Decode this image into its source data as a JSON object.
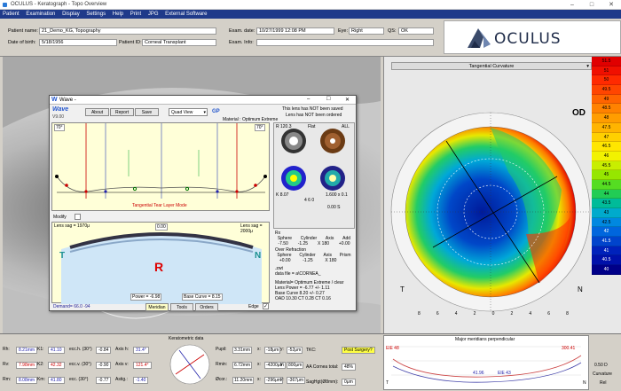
{
  "window": {
    "title": "OCULUS - Keratograph - Topo Overview"
  },
  "menu": [
    "Patient",
    "Examination",
    "Display",
    "Settings",
    "Help",
    "Print",
    "JPG",
    "External Software"
  ],
  "patient": {
    "name_label": "Patient name:",
    "name": "21_Demo_KG, Topography",
    "dob_label": "Date of birth:",
    "dob": "5/18/1956",
    "id_label": "Patient ID:",
    "id": "Corneal Transplant",
    "exam_date_label": "Exam. date:",
    "exam_date": "10/27/1999 12:08 PM",
    "eye_label": "Eye:",
    "eye": "Right",
    "qs_label": "QS:",
    "qs": "OK",
    "exam_info_label": "Exam. Info:",
    "exam_info": ""
  },
  "brand": "OCULUS",
  "map": {
    "dropdown": "Tangential Curvature",
    "eye": "OD",
    "left_label": "T",
    "right_label": "N",
    "axis_ticks": [
      "8",
      "6",
      "4",
      "2",
      "0",
      "2",
      "4",
      "6",
      "8"
    ]
  },
  "scale": {
    "values": [
      "51.5",
      "51",
      "50",
      "49.5",
      "49",
      "48.5",
      "48",
      "47.5",
      "47",
      "46.5",
      "46",
      "45.5",
      "45",
      "44.5",
      "44",
      "43.5",
      "43",
      "42.5",
      "42",
      "41.5",
      "41",
      "40.5",
      "40"
    ],
    "colors": [
      "#e00000",
      "#f01000",
      "#ff2a00",
      "#ff4500",
      "#ff6400",
      "#ff8200",
      "#ff9d00",
      "#ffb400",
      "#ffd000",
      "#ffe600",
      "#f2f200",
      "#c8ee00",
      "#96e600",
      "#55dd22",
      "#22cc55",
      "#00bb99",
      "#00aacc",
      "#0088e0",
      "#0066dd",
      "#0044cc",
      "#0022bb",
      "#0011aa",
      "#000088"
    ],
    "step": "0.50 D",
    "unit_label": "Curvature",
    "abs": "Rel"
  },
  "wave": {
    "title": "Wave -",
    "version": "V9.00",
    "buttons": [
      "About",
      "Report",
      "Save"
    ],
    "view": "Quad View",
    "gp": "GP",
    "material": "Material : Optimum Extreme",
    "warn1": "This lens has NOT been saved",
    "warn2": "Lens has NOT been ordered",
    "mode": "Tangential Tear Layer Mode",
    "modify": "Modify",
    "sag_left": "Lens sag = 1970μ",
    "sag_right": "Lens sag = 2000μ",
    "left_box": "70°",
    "right_box": "70°",
    "top_val": "0.00",
    "letters": {
      "t": "T",
      "r": "R",
      "n": "N"
    },
    "power": "Power = -6.98",
    "base": "Base Curve = 8.15",
    "demand": "Demand= 66.0 -94",
    "tabs": [
      "Meridian",
      "Tools",
      "Orders"
    ],
    "edge": "Edge",
    "rx_title": "Rx",
    "rx_headers": [
      "Sphere",
      "Cylinder",
      "Axis",
      "Add"
    ],
    "rx_values": [
      "-7.50",
      "-1.25",
      "X 180",
      "+0.00"
    ],
    "over_title": "Over Refraction",
    "over_headers": [
      "Sphere",
      "Cylinder",
      "Axis",
      "Prism"
    ],
    "over_values": [
      "+0.00",
      "-1.25",
      "X 180",
      ""
    ],
    "zwt": ".zwt",
    "data_file": "data file = a\\CORNEA_",
    "notes": [
      "Material= Optimum Extreme / clear",
      "Lens Power = -6.77 +/- 1.11",
      "Base Curve 8.20 +/- 0.27",
      "OAD 10.30 CT 0.28 CT 0.16"
    ],
    "thumb_labels": [
      "R 120.3",
      "Flat",
      "ALL",
      "K 8.07",
      "4 6 0",
      "1.600 x 0.1"
    ],
    "zoom": "0.00 S"
  },
  "kerato": {
    "title": "Keratometric data",
    "rows": [
      {
        "c1": "Rh:",
        "v1": "8.21mm",
        "c2": "K1:",
        "v2": "41.10",
        "c3": "ecc.h. (30°)",
        "v3": "-0.84",
        "c4": "Axis h:",
        "v4": "31.4°"
      },
      {
        "c1": "Rv:",
        "v1": "7.98mm",
        "c2": "K2:",
        "v2": "42.32",
        "c3": "ecc.v. (30°)",
        "v3": "-0.90",
        "c4": "Axis v:",
        "v4": "121.4°"
      },
      {
        "c1": "Rm:",
        "v1": "8.08mm",
        "c2": "Km:",
        "v2": "41.80",
        "c3": "ecc. (30°)",
        "v3": "-0.77",
        "c4": "Astig.:",
        "v4": "-1.40"
      }
    ],
    "meas": [
      {
        "a": "Pupil:",
        "av": "3.31mm",
        "b": "x:",
        "bv": "-18μm",
        "c": "y:",
        "cv": "-52μm"
      },
      {
        "a": "Rmin:",
        "av": "6.72mm",
        "b": "x:",
        "bv": "-4200μm",
        "c": "y:",
        "cv": "800μm"
      },
      {
        "a": "Øcor.:",
        "av": "11.20mm",
        "b": "x:",
        "bv": "-296μm",
        "c": "y:",
        "cv": "-367μm"
      }
    ],
    "tkc": "TKC:",
    "tkc_val": "Post Surgery?",
    "aa": "AA Cornea total:",
    "aa_val": "48%",
    "sag": "SagHgt(Ø8mm):",
    "sag_val": "0μm"
  },
  "meridians": {
    "title": "Major meridians perpendicular",
    "left_label": "T",
    "right_label": "N",
    "l1": "ElE 48",
    "l2": "ElE 43",
    "mark1": "300.41",
    "mark2": "41.96"
  }
}
